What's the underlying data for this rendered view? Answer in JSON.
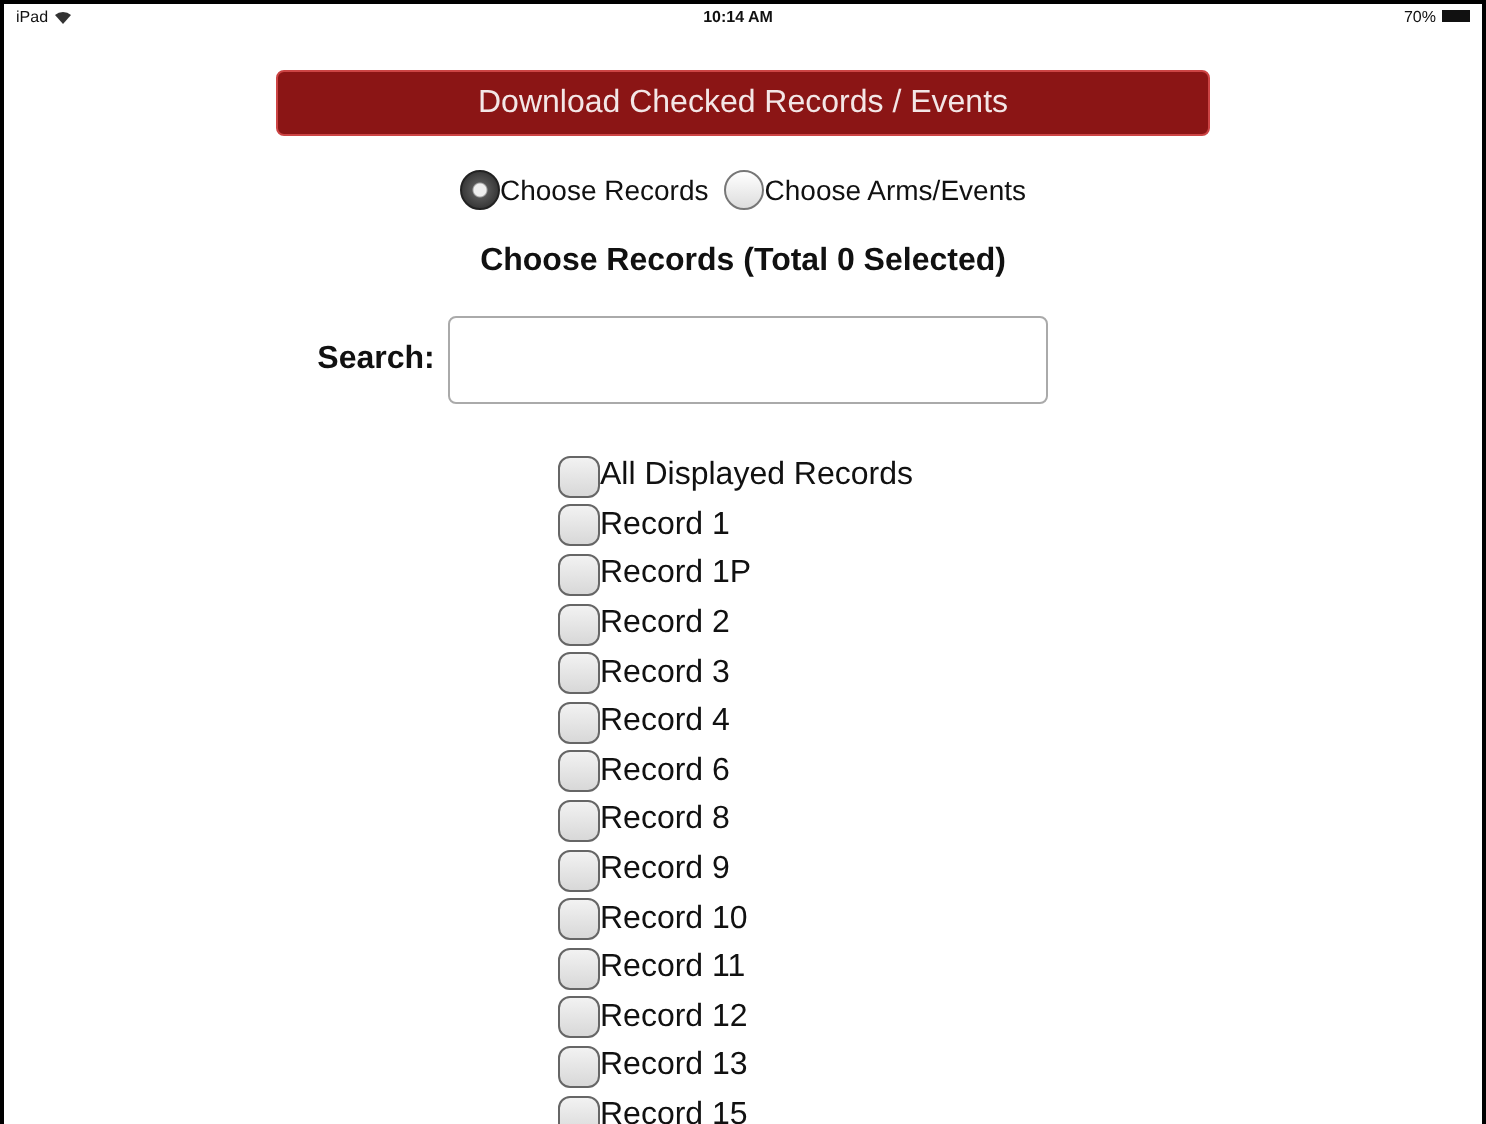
{
  "status_bar": {
    "device": "iPad",
    "time": "10:14 AM",
    "battery": "70%"
  },
  "download_button": "Download Checked Records / Events",
  "modes": [
    {
      "label": "Choose Records",
      "selected": true
    },
    {
      "label": "Choose Arms/Events",
      "selected": false
    }
  ],
  "heading": "Choose Records (Total 0 Selected)",
  "search": {
    "label": "Search:"
  },
  "records": [
    {
      "label": "All Displayed Records",
      "checked": false
    },
    {
      "label": "Record 1",
      "checked": false
    },
    {
      "label": "Record 1P",
      "checked": false
    },
    {
      "label": "Record 2",
      "checked": false
    },
    {
      "label": "Record 3",
      "checked": false
    },
    {
      "label": "Record 4",
      "checked": false
    },
    {
      "label": "Record 6",
      "checked": false
    },
    {
      "label": "Record 8",
      "checked": false
    },
    {
      "label": "Record 9",
      "checked": false
    },
    {
      "label": "Record 10",
      "checked": false
    },
    {
      "label": "Record 11",
      "checked": false
    },
    {
      "label": "Record 12",
      "checked": false
    },
    {
      "label": "Record 13",
      "checked": false
    },
    {
      "label": "Record 15",
      "checked": false
    }
  ]
}
